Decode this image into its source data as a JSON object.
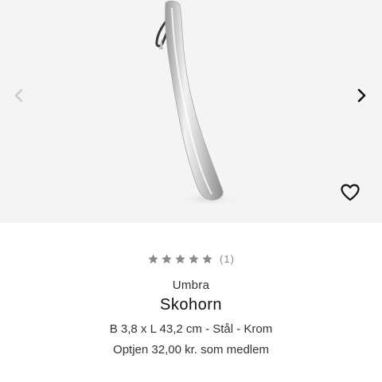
{
  "gallery": {
    "prev_icon": "chevron-left-icon",
    "next_icon": "chevron-right-icon",
    "favorite_icon": "heart-outline-icon"
  },
  "product": {
    "rating": {
      "stars": 5,
      "count_label": "(1)"
    },
    "brand": "Umbra",
    "title": "Skohorn",
    "description": "B 3,8 x L 43,2 cm - Stål - Krom",
    "member_offer": "Optjen 32,00 kr. som medlem"
  },
  "colors": {
    "star": "#8a8a8a",
    "background_gallery": "#f4f4f4",
    "nav_active": "#111111",
    "nav_inactive": "#c9c9c9"
  }
}
